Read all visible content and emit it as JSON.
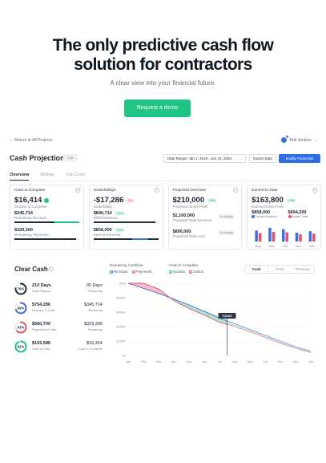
{
  "hero": {
    "title_line1": "The only predictive cash flow",
    "title_line2": "solution for contractors",
    "subtitle": "A clear view into your financial future.",
    "cta": "Request a demo"
  },
  "app": {
    "back_link": "← Return to All Projects",
    "user_name": "Bob Jenkins",
    "notification_count": "2",
    "page_title": "Cash Projections",
    "edit_label": "Edit",
    "date_range": "Date Range: Jan 1, 2019 - Jan 15, 2020",
    "export_label": "Export Data",
    "modify_label": "Modify Financials",
    "tabs": [
      "Overview",
      "Billings",
      "Job Costs"
    ]
  },
  "cards": {
    "cash_to_complete": {
      "title": "Cash to Complete",
      "value": "$16,414",
      "caption": "Surplus to Complete",
      "receipts_value": "$345,714",
      "receipts_label": "Remaining Receipts",
      "payments_value": "$329,300",
      "payments_label": "Remaining Payments"
    },
    "underbillings": {
      "title": "Underbillings",
      "value": "-$17,286",
      "pill": "-5%",
      "caption": "Underbilled",
      "billed_value": "$840,714",
      "billed_pill": "+15%",
      "billed_label": "Billed Revenue",
      "earned_value": "$858,000",
      "earned_pill": "+20%",
      "earned_label": "Earned Revenue"
    },
    "projected_overview": {
      "title": "Projected Overview",
      "value": "$210,000",
      "pill": "+19%",
      "caption": "Projected Gross Profit",
      "revenue_value": "$1,100,000",
      "revenue_tag": "6 changes",
      "revenue_label": "Projected Total Revenue",
      "cost_value": "$890,000",
      "cost_tag": "9 changes",
      "cost_label": "Projected Total Cost"
    },
    "earned_to_date": {
      "title": "Earned to Date",
      "value": "$163,800",
      "pill": "+23%",
      "caption": "Earned Gross Profit",
      "earned_value": "$858,000",
      "earned_label": "Earned Revenue",
      "cost_value": "$694,200",
      "cost_label": "Actual Costs",
      "months": [
        "Aug",
        "Sep",
        "Oct",
        "Nov",
        "Dec"
      ],
      "earned_bars": [
        0.62,
        0.78,
        0.7,
        0.5,
        0.58
      ],
      "cost_bars": [
        0.48,
        0.55,
        0.52,
        0.4,
        0.45
      ],
      "colors": {
        "earned": "#3b6fe0",
        "cost": "#e5506a"
      }
    }
  },
  "clear_cash": {
    "title": "Clear Cash",
    "metrics": [
      {
        "pct": "76%",
        "ratio": 0.76,
        "color": "#1f2b3a",
        "value": "210 Days",
        "label": "Days Elapsed",
        "rvalue": "90 Days",
        "rlabel": "Remaining"
      },
      {
        "pct": "69%",
        "ratio": 0.69,
        "color": "#3b6fe0",
        "value": "$754,286",
        "label": "Receipts to Date",
        "rvalue": "$345,714",
        "rlabel": "Remaining"
      },
      {
        "pct": "63%",
        "ratio": 0.63,
        "color": "#e5506a",
        "value": "$560,700",
        "label": "Payments to Date",
        "rvalue": "$329,300",
        "rlabel": "Remaining"
      },
      {
        "pct": "92%",
        "ratio": 0.92,
        "color": "#20c586",
        "value": "$193,586",
        "label": "Cash to Date",
        "rvalue": "$16,414",
        "rlabel": "Cash to Complete"
      }
    ],
    "legend_remaining": "Remaining Cashflow",
    "legend_receipts": "Receipts",
    "legend_payments": "Payments",
    "legend_complete": "Cash to Complete",
    "legend_surplus": "Surplus",
    "legend_deficit": "Deficit",
    "segments": [
      "Cash",
      "Profit",
      "Revenue"
    ]
  },
  "chart_data": {
    "type": "line",
    "x": [
      "Jan",
      "Feb",
      "Mar",
      "Apr",
      "May",
      "Jun",
      "Jul",
      "Aug",
      "Sep",
      "Oct",
      "Nov",
      "Dec",
      "Jan"
    ],
    "y_ticks": [
      "$1M",
      "$800K",
      "$600K",
      "$400K",
      "$200K",
      "$0"
    ],
    "ylim": [
      0,
      1000000
    ],
    "today_label": "TODAY",
    "today_index": 6.5,
    "series": [
      {
        "name": "Receipts",
        "color": "#3b6fe0",
        "values": [
          1000000,
          930000,
          860000,
          780000,
          700000,
          610000,
          520000,
          440000,
          360000,
          280000,
          200000,
          120000,
          60000
        ]
      },
      {
        "name": "Payments",
        "color": "#e5506a",
        "values": [
          1000000,
          1000000,
          920000,
          760000,
          650000,
          560000,
          460000,
          400000,
          330000,
          250000,
          170000,
          100000,
          40000
        ]
      }
    ],
    "colors": {
      "surplus": "#9fe2c5",
      "deficit": "#f6b3bd"
    }
  }
}
